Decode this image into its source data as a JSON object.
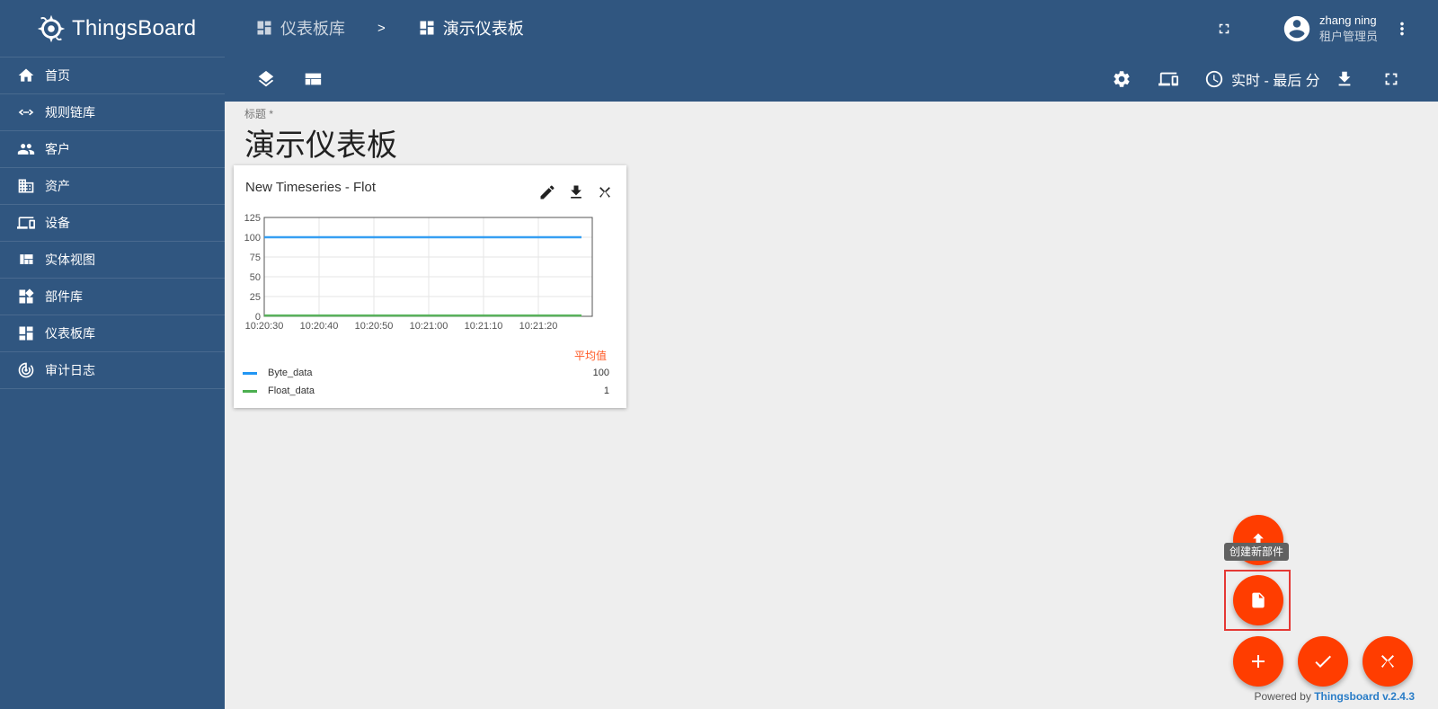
{
  "app": {
    "brand": "ThingsBoard"
  },
  "sidebar": {
    "items": [
      {
        "label": "首页",
        "icon": "home-icon"
      },
      {
        "label": "规则链库",
        "icon": "code-arrows-icon"
      },
      {
        "label": "客户",
        "icon": "people-icon"
      },
      {
        "label": "资产",
        "icon": "building-icon"
      },
      {
        "label": "设备",
        "icon": "devices-icon"
      },
      {
        "label": "实体视图",
        "icon": "view-quilt-icon"
      },
      {
        "label": "部件库",
        "icon": "widgets-icon"
      },
      {
        "label": "仪表板库",
        "icon": "dashboard-icon"
      },
      {
        "label": "审计日志",
        "icon": "track-changes-icon"
      }
    ]
  },
  "header": {
    "breadcrumbs": [
      {
        "label": "仪表板库"
      },
      {
        "label": "演示仪表板"
      }
    ],
    "separator": ">",
    "user": {
      "name": "zhang ning",
      "role": "租户管理员"
    },
    "timewindow_label": "实时 - 最后 分"
  },
  "dashboard": {
    "title_label": "标题 *",
    "title_value": "演示仪表板"
  },
  "widget": {
    "title": "New Timeseries - Flot",
    "legend_header": "平均值",
    "legend": [
      {
        "name": "Byte_data",
        "value": "100",
        "color": "#2196f3"
      },
      {
        "name": "Float_data",
        "value": "1",
        "color": "#4caf50"
      }
    ]
  },
  "chart_data": {
    "type": "line",
    "x": [
      "10:20:30",
      "10:20:40",
      "10:20:50",
      "10:21:00",
      "10:21:10",
      "10:21:20"
    ],
    "ylim": [
      0,
      125
    ],
    "yticks": [
      0,
      25,
      50,
      75,
      100,
      125
    ],
    "grid": true,
    "series": [
      {
        "name": "Byte_data",
        "values": [
          100,
          100,
          100,
          100,
          100,
          100
        ],
        "color": "#2196f3"
      },
      {
        "name": "Float_data",
        "values": [
          1,
          1,
          1,
          1,
          1,
          1
        ],
        "color": "#4caf50"
      }
    ]
  },
  "fab": {
    "tooltip": "创建新部件",
    "color": "#ff3d00"
  },
  "footer": {
    "powered_prefix": "Powered by",
    "powered_brand": "Thingsboard v.2.4.3"
  }
}
